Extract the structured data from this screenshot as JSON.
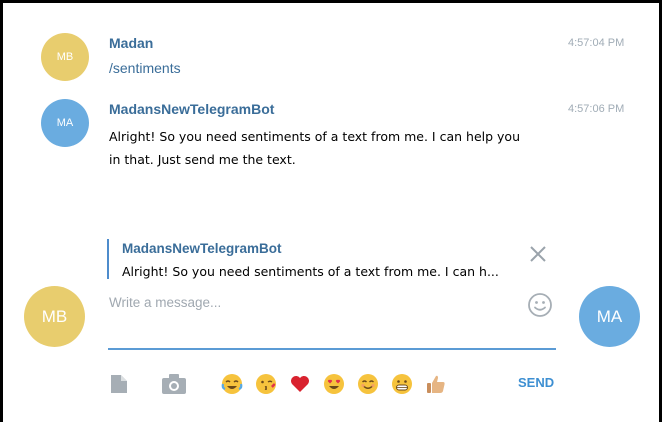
{
  "messages": [
    {
      "avatar_initials": "MB",
      "sender": "Madan",
      "time": "4:57:04 PM",
      "text": "/sentiments"
    },
    {
      "avatar_initials": "MA",
      "sender": "MadansNewTelegramBot",
      "time": "4:57:06 PM",
      "text_line1": "Alright! So you need sentiments of a text from me. I can help you",
      "text_line2": "in that. Just send me the text."
    }
  ],
  "reply": {
    "sender": "MadansNewTelegramBot",
    "text": "Alright! So you need sentiments of a text from me. I can h..."
  },
  "composer": {
    "left_avatar": "MB",
    "right_avatar": "MA",
    "placeholder": "Write a message...",
    "send_label": "SEND"
  },
  "quick_emojis": [
    "joy-tears",
    "kiss",
    "red-heart",
    "heart-eyes",
    "smile",
    "grimace",
    "thumbs-up"
  ],
  "icons": {
    "attach": "file-icon",
    "camera": "camera-icon",
    "emoji_picker": "smiley-icon",
    "close_reply": "close-icon"
  },
  "colors": {
    "avatar_mb": "#e8cd6e",
    "avatar_ma": "#6aace0",
    "sender_name": "#3a6d99",
    "accent": "#3d8fd2",
    "timestamp": "#a0acb6"
  }
}
